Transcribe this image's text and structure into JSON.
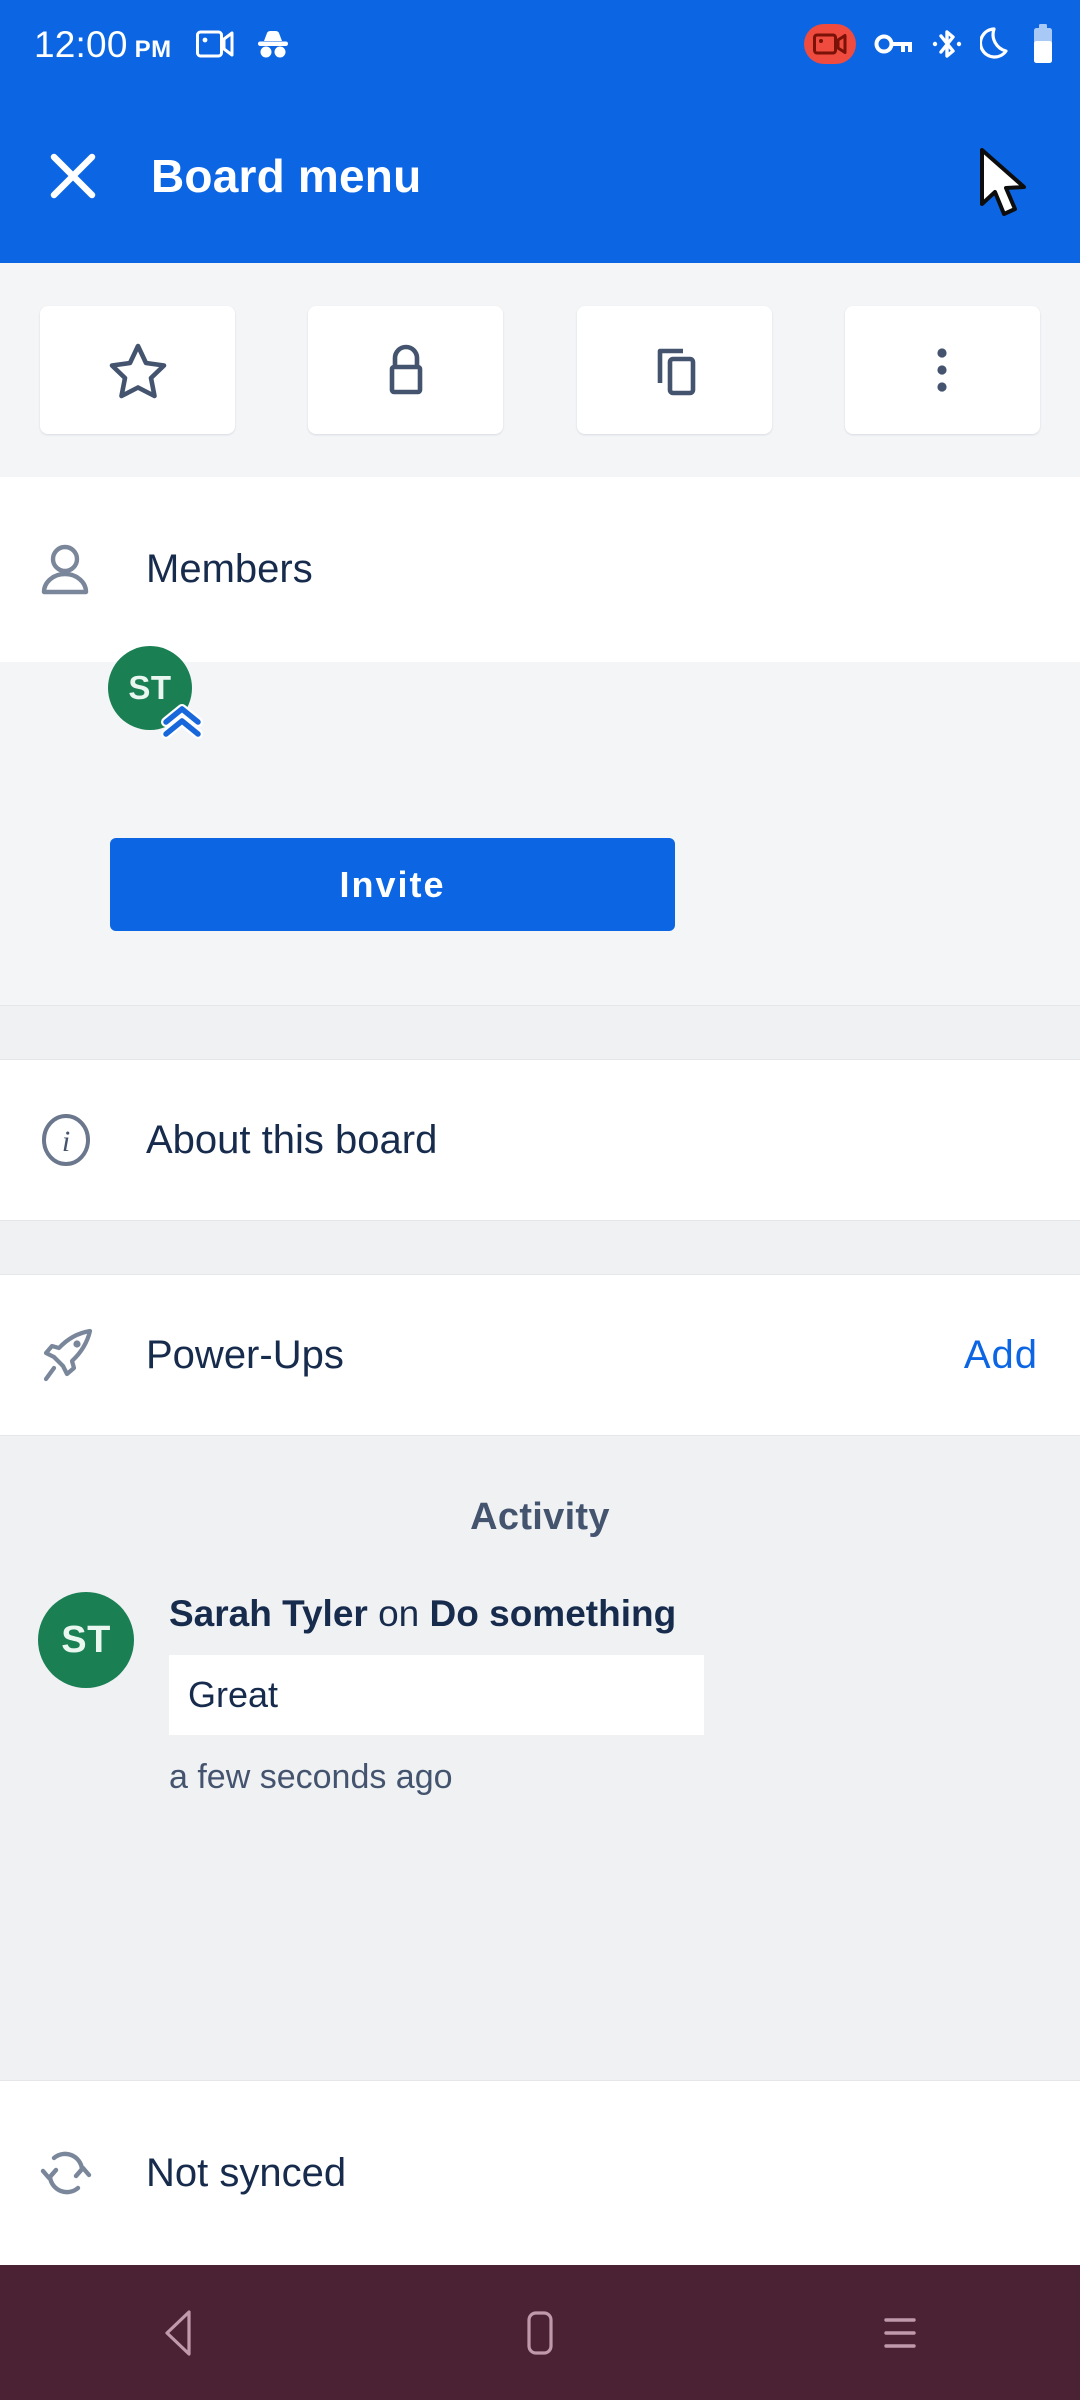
{
  "status_bar": {
    "time": "12:00",
    "meridiem": "PM",
    "left_icons": [
      "screen-record-icon",
      "incognito-icon"
    ],
    "right_icons": [
      "screen-record-active-icon",
      "vpn-key-icon",
      "bluetooth-icon",
      "do-not-disturb-moon-icon",
      "battery-icon"
    ],
    "accent_color": "#0c66e4",
    "recording_badge_color": "#ef4b3f"
  },
  "app_bar": {
    "close_label": "close-icon",
    "title": "Board menu"
  },
  "quick_actions": [
    {
      "name": "star-button",
      "icon": "star-icon"
    },
    {
      "name": "visibility-button",
      "icon": "lock-icon"
    },
    {
      "name": "copy-board-button",
      "icon": "copy-icon"
    },
    {
      "name": "more-options-button",
      "icon": "overflow-menu-icon"
    }
  ],
  "members": {
    "label": "Members",
    "icon": "person-icon",
    "avatars": [
      {
        "initials": "ST",
        "color": "#1a7f53",
        "badge": "admin-chevrons-icon"
      }
    ],
    "invite_label": "Invite"
  },
  "about": {
    "label": "About this board",
    "icon": "info-icon"
  },
  "power_ups": {
    "label": "Power-Ups",
    "icon": "rocket-icon",
    "action_label": "Add",
    "action_color": "#0c66e4"
  },
  "activity": {
    "title": "Activity",
    "items": [
      {
        "initials": "ST",
        "avatar_color": "#1a7f53",
        "actor": "Sarah Tyler",
        "preposition": "on",
        "target": "Do something",
        "comment": "Great",
        "timestamp": "a few seconds ago"
      }
    ]
  },
  "sync": {
    "label": "Not synced",
    "icon": "sync-icon"
  },
  "nav_bar": {
    "background": "#4a2233",
    "buttons": [
      {
        "name": "nav-back-button",
        "icon": "back-triangle-icon"
      },
      {
        "name": "nav-home-button",
        "icon": "home-rounded-rect-icon"
      },
      {
        "name": "nav-recents-button",
        "icon": "recents-lines-icon"
      }
    ]
  }
}
